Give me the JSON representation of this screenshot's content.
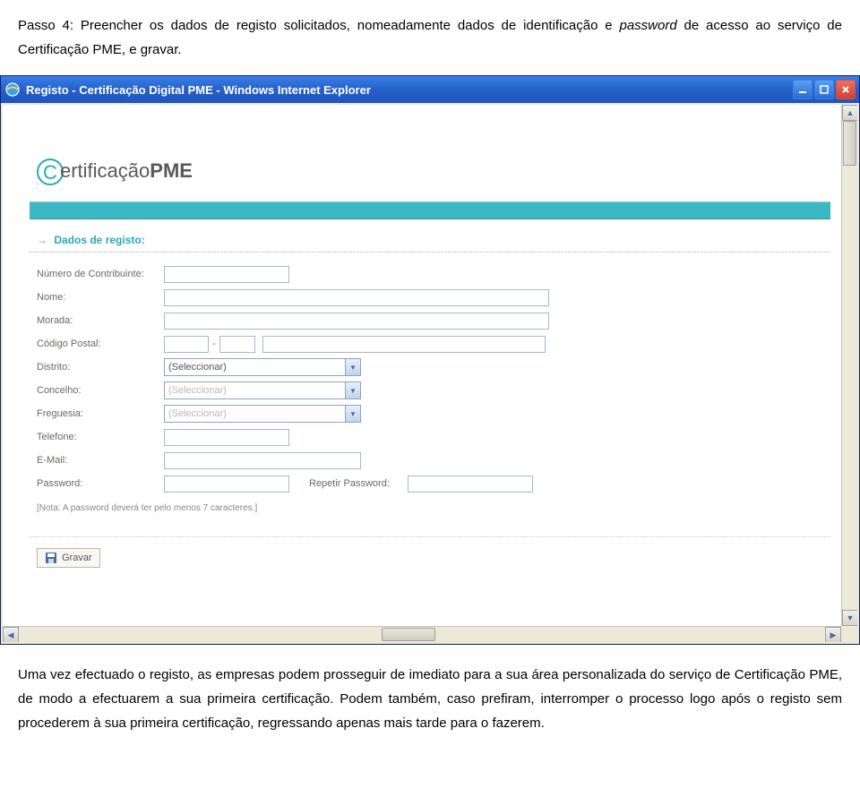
{
  "doc": {
    "para1_a": "Passo 4: Preencher os dados de registo solicitados, nomeadamente dados de identificação e ",
    "para1_b": "password",
    "para1_c": " de acesso ao serviço de Certificação PME, e gravar.",
    "para2": "Uma vez efectuado o registo, as empresas podem prosseguir de imediato para a sua área personalizada do serviço de Certificação PME, de modo a efectuarem a sua primeira certificação. Podem também, caso prefiram, interromper o processo logo após o registo sem procederem à sua primeira certificação, regressando apenas mais tarde para o fazerem."
  },
  "window": {
    "title": "Registo - Certificação Digital PME - Windows Internet Explorer"
  },
  "logo": {
    "text_a": "ertificação",
    "text_b": "PME"
  },
  "section": {
    "title": "Dados de registo:"
  },
  "form": {
    "nif_label": "Número de Contribuinte:",
    "nome_label": "Nome:",
    "morada_label": "Morada:",
    "cp_label": "Código Postal:",
    "distrito_label": "Distrito:",
    "concelho_label": "Concelho:",
    "freguesia_label": "Freguesia:",
    "telefone_label": "Telefone:",
    "email_label": "E-Mail:",
    "password_label": "Password:",
    "repeat_label": "Repetir Password:",
    "select_placeholder": "(Seleccionar)",
    "note": "[Nota: A password deverá ter pelo menos 7 caracteres.]",
    "save": "Gravar"
  }
}
